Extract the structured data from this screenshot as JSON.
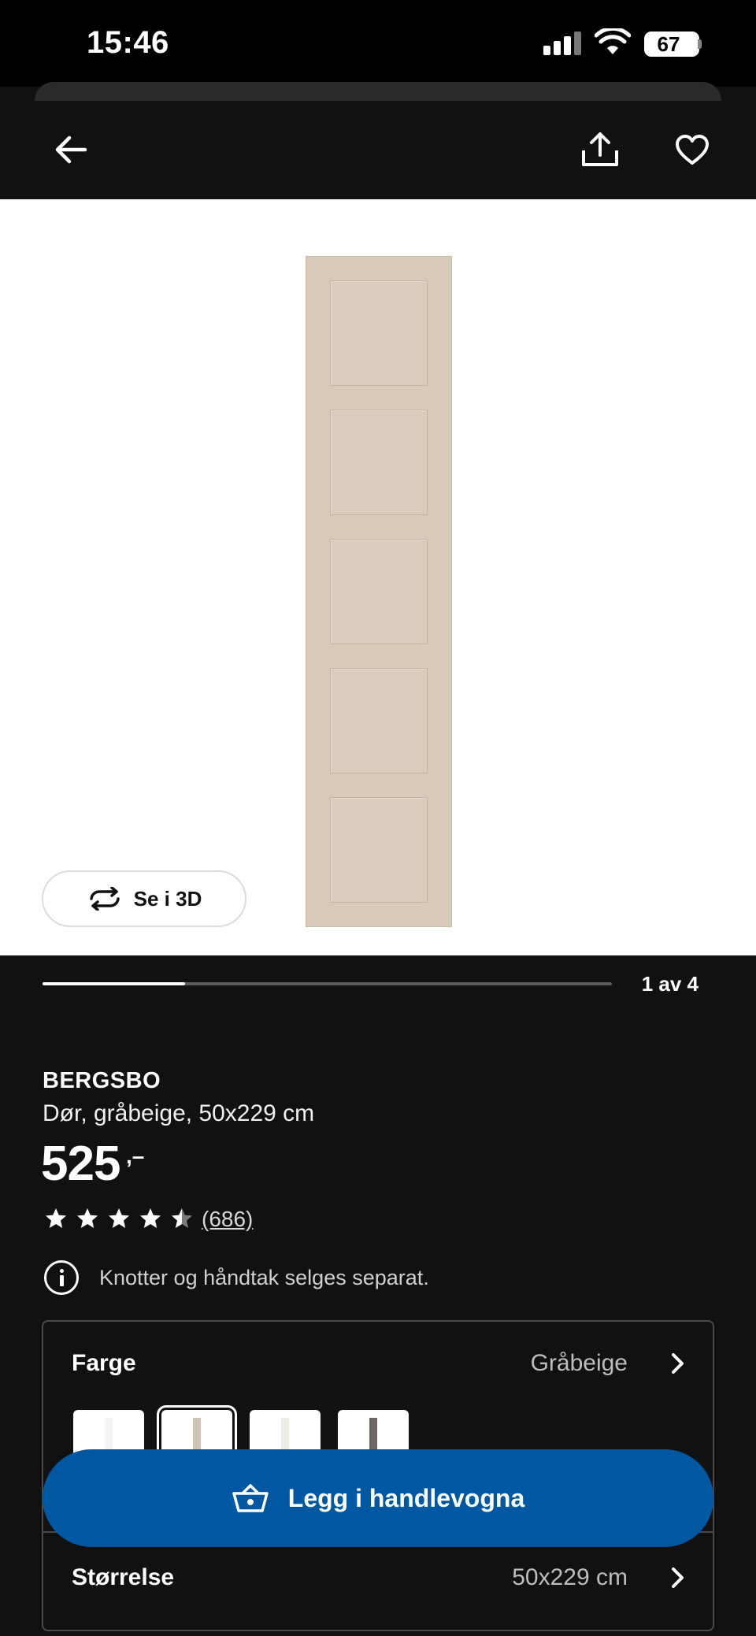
{
  "status_bar": {
    "time": "15:46",
    "battery": "67"
  },
  "nav": {
    "back_icon": "arrow-left-icon",
    "share_icon": "share-icon",
    "favorite_icon": "heart-icon"
  },
  "gallery": {
    "view_3d_label": "Se i 3D",
    "counter": "1 av 4",
    "progress": 0.25
  },
  "product": {
    "name": "BERGSBO",
    "description": "Dør, gråbeige, 50x229 cm",
    "price": "525",
    "price_suffix": ",–",
    "rating": 4.5,
    "rating_count": "(686)",
    "info_note": "Knotter og håndtak selges separat."
  },
  "options": {
    "color": {
      "label": "Farge",
      "value": "Gråbeige",
      "swatches": [
        {
          "color": "#f4f4f2",
          "selected": false
        },
        {
          "color": "#d3c3b2",
          "selected": true
        },
        {
          "color": "#eeeee6",
          "selected": false
        },
        {
          "color": "#6e6664",
          "selected": false
        }
      ]
    },
    "size": {
      "label": "Størrelse",
      "value": "50x229 cm"
    }
  },
  "cart": {
    "label": "Legg i handlevogna"
  },
  "colors": {
    "brand_blue": "#0058a3",
    "background": "#111112"
  }
}
